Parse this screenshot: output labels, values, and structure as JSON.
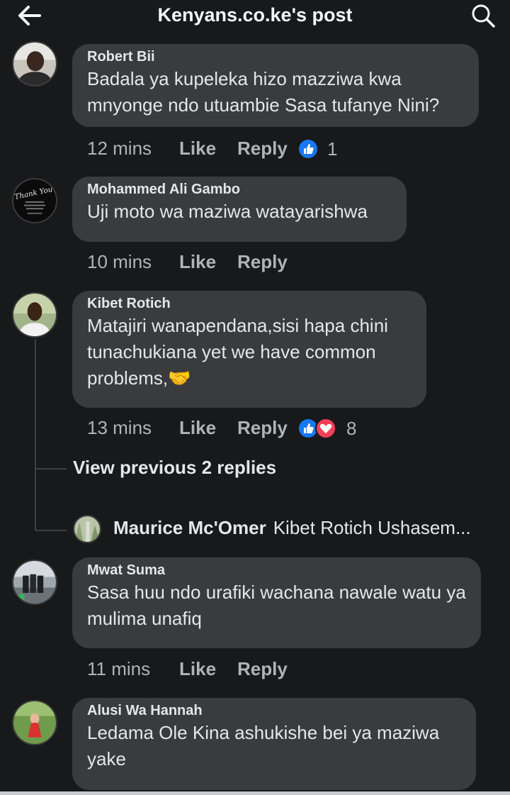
{
  "header": {
    "title": "Kenyans.co.ke's post"
  },
  "comments": [
    {
      "author": "Robert Bii",
      "text": "Badala ya kupeleka hizo mazziwa kwa mnyonge ndo utuambie Sasa tufanye Nini?",
      "time": "12 mins",
      "like": "Like",
      "reply": "Reply",
      "reaction_count": "1"
    },
    {
      "author": "Mohammed Ali Gambo",
      "text": "Uji moto wa maziwa watayarishwa",
      "time": "10 mins",
      "like": "Like",
      "reply": "Reply"
    },
    {
      "author": "Kibet Rotich",
      "text": "Matajiri wanapendana,sisi hapa chini tunachukiana yet we have common problems,🤝",
      "time": "13 mins",
      "like": "Like",
      "reply": "Reply",
      "reaction_count": "8"
    },
    {
      "author": "Mwat Suma",
      "text": "Sasa huu ndo urafiki wachana nawale watu ya mulima unafiq",
      "time": "11 mins",
      "like": "Like",
      "reply": "Reply"
    },
    {
      "author": "Alusi Wa Hannah",
      "text": "Ledama Ole Kina ashukishe bei ya maziwa yake"
    }
  ],
  "thread": {
    "view_previous": "View previous 2 replies",
    "reply_author": "Maurice Mc'Omer",
    "reply_preview": "Kibet Rotich Ushasem..."
  },
  "avatar_text": {
    "thank_you": "Thank You"
  },
  "colors": {
    "background": "#18191a",
    "bubble": "#3a3b3c",
    "text": "#e4e6eb",
    "muted": "#b0b3b8",
    "like_blue": "#1877f2",
    "love_red": "#f33e58"
  },
  "icons": [
    "back-arrow-icon",
    "search-icon",
    "like-reaction-icon",
    "love-reaction-icon"
  ]
}
